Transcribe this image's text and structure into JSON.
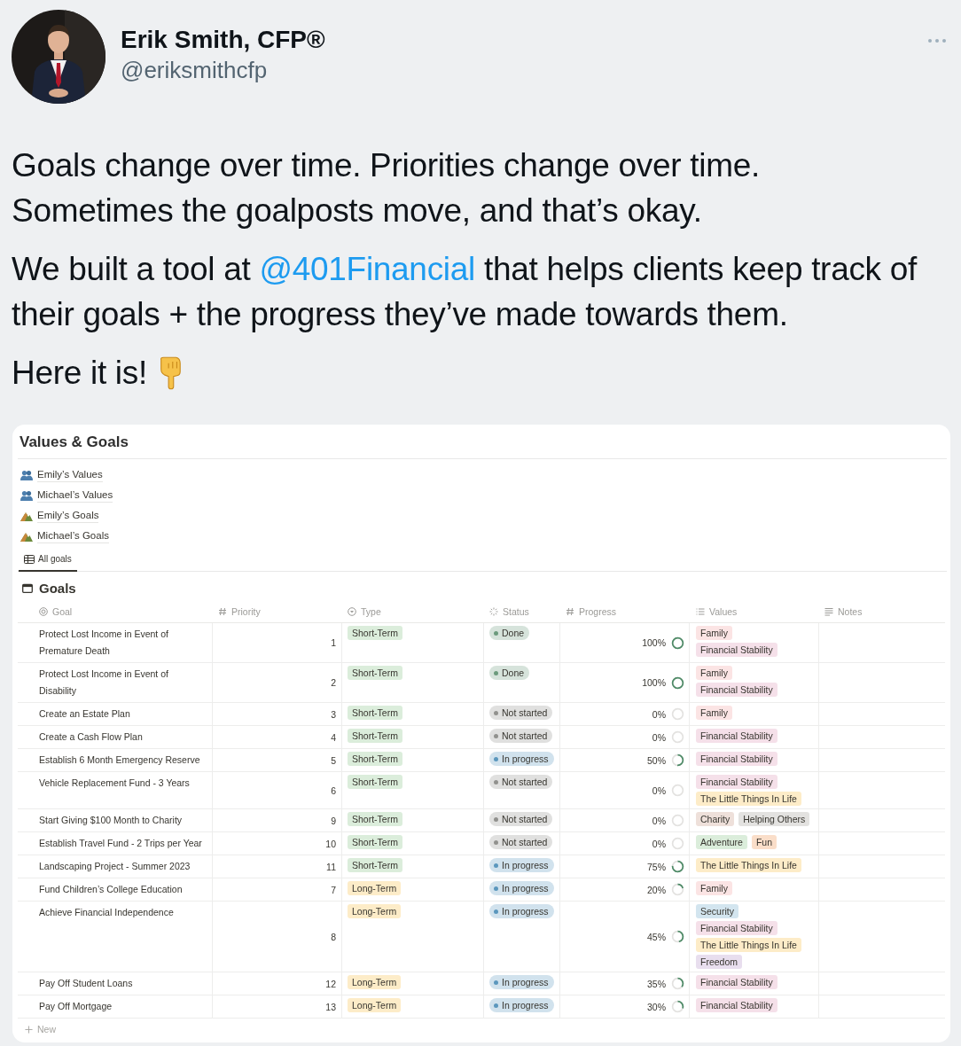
{
  "tweet": {
    "author": {
      "name": "Erik Smith, CFP®",
      "handle": "@eriksmithcfp"
    },
    "paragraphs": [
      {
        "text": "Goals change over time. Priorities change over time.\nSometimes the goalposts move, and that’s okay."
      },
      {
        "before": "We built a tool at ",
        "link": "@401Financial",
        "after": " that helps clients keep track of their goals + the progress they’ve made towards them."
      },
      {
        "text": "Here it is!"
      }
    ]
  },
  "notion": {
    "title": "Values & Goals",
    "links": [
      {
        "label": "Emily’s Values",
        "kind": "values"
      },
      {
        "label": "Michael’s Values",
        "kind": "values"
      },
      {
        "label": "Emily’s Goals",
        "kind": "goals"
      },
      {
        "label": "Michael’s Goals",
        "kind": "goals"
      }
    ],
    "view_tab": {
      "label": "All goals",
      "selected": true
    },
    "database_title": "Goals",
    "columns": [
      {
        "label": "Goal",
        "kind": "title"
      },
      {
        "label": "Priority",
        "kind": "number"
      },
      {
        "label": "Type",
        "kind": "select"
      },
      {
        "label": "Status",
        "kind": "status"
      },
      {
        "label": "Progress",
        "kind": "number"
      },
      {
        "label": "Values",
        "kind": "multi"
      },
      {
        "label": "Notes",
        "kind": "text"
      }
    ],
    "rows": [
      {
        "goal": "Protect Lost Income in Event of Premature Death",
        "priority": "1",
        "type": {
          "label": "Short-Term",
          "color": "#dbeddb"
        },
        "status": {
          "label": "Done",
          "color": "#6c9b7d"
        },
        "progress": "100%",
        "value_lines": [
          [
            {
              "label": "Family",
              "color": "#fbe4e4"
            }
          ],
          [
            {
              "label": "Financial Stability",
              "color": "#f5e0e9"
            }
          ]
        ]
      },
      {
        "goal": "Protect Lost Income in Event of Disability",
        "priority": "2",
        "type": {
          "label": "Short-Term",
          "color": "#dbeddb"
        },
        "status": {
          "label": "Done",
          "color": "#6c9b7d"
        },
        "progress": "100%",
        "value_lines": [
          [
            {
              "label": "Family",
              "color": "#fbe4e4"
            }
          ],
          [
            {
              "label": "Financial Stability",
              "color": "#f5e0e9"
            }
          ]
        ]
      },
      {
        "goal": "Create an Estate Plan",
        "priority": "3",
        "type": {
          "label": "Short-Term",
          "color": "#dbeddb"
        },
        "status": {
          "label": "Not started",
          "color": "#91918e"
        },
        "progress": "0%",
        "value_lines": [
          [
            {
              "label": "Family",
              "color": "#fbe4e4"
            }
          ]
        ]
      },
      {
        "goal": "Create a Cash Flow Plan",
        "priority": "4",
        "type": {
          "label": "Short-Term",
          "color": "#dbeddb"
        },
        "status": {
          "label": "Not started",
          "color": "#91918e"
        },
        "progress": "0%",
        "value_lines": [
          [
            {
              "label": "Financial Stability",
              "color": "#f5e0e9"
            }
          ]
        ]
      },
      {
        "goal": "Establish 6 Month Emergency Reserve",
        "priority": "5",
        "type": {
          "label": "Short-Term",
          "color": "#dbeddb"
        },
        "status": {
          "label": "In progress",
          "color": "#5b97bd"
        },
        "progress": "50%",
        "value_lines": [
          [
            {
              "label": "Financial Stability",
              "color": "#f5e0e9"
            }
          ]
        ]
      },
      {
        "goal": "Vehicle Replacement Fund - 3 Years",
        "priority": "6",
        "type": {
          "label": "Short-Term",
          "color": "#dbeddb"
        },
        "status": {
          "label": "Not started",
          "color": "#91918e"
        },
        "progress": "0%",
        "value_lines": [
          [
            {
              "label": "Financial Stability",
              "color": "#f5e0e9"
            }
          ],
          [
            {
              "label": "The Little Things In Life",
              "color": "#fdecc8"
            }
          ]
        ]
      },
      {
        "goal": "Start Giving $100 Month to Charity",
        "priority": "9",
        "type": {
          "label": "Short-Term",
          "color": "#dbeddb"
        },
        "status": {
          "label": "Not started",
          "color": "#91918e"
        },
        "progress": "0%",
        "value_lines": [
          [
            {
              "label": "Charity",
              "color": "#eee0da"
            },
            {
              "label": "Helping Others",
              "color": "#e3e2e0"
            }
          ]
        ]
      },
      {
        "goal": "Establish Travel Fund - 2 Trips per Year",
        "priority": "10",
        "type": {
          "label": "Short-Term",
          "color": "#dbeddb"
        },
        "status": {
          "label": "Not started",
          "color": "#91918e"
        },
        "progress": "0%",
        "value_lines": [
          [
            {
              "label": "Adventure",
              "color": "#dbeddb"
            },
            {
              "label": "Fun",
              "color": "#fadec9"
            }
          ]
        ]
      },
      {
        "goal": "Landscaping Project - Summer 2023",
        "priority": "11",
        "type": {
          "label": "Short-Term",
          "color": "#dbeddb"
        },
        "status": {
          "label": "In progress",
          "color": "#5b97bd"
        },
        "progress": "75%",
        "value_lines": [
          [
            {
              "label": "The Little Things In Life",
              "color": "#fdecc8"
            }
          ]
        ]
      },
      {
        "goal": "Fund Children’s College Education",
        "priority": "7",
        "type": {
          "label": "Long-Term",
          "color": "#fdecc8"
        },
        "status": {
          "label": "In progress",
          "color": "#5b97bd"
        },
        "progress": "20%",
        "value_lines": [
          [
            {
              "label": "Family",
              "color": "#fbe4e4"
            }
          ]
        ]
      },
      {
        "goal": "Achieve Financial Independence",
        "priority": "8",
        "type": {
          "label": "Long-Term",
          "color": "#fdecc8"
        },
        "status": {
          "label": "In progress",
          "color": "#5b97bd"
        },
        "progress": "45%",
        "value_lines": [
          [
            {
              "label": "Security",
              "color": "#d3e5ef"
            }
          ],
          [
            {
              "label": "Financial Stability",
              "color": "#f5e0e9"
            }
          ],
          [
            {
              "label": "The Little Things In Life",
              "color": "#fdecc8"
            }
          ],
          [
            {
              "label": "Freedom",
              "color": "#e8deee"
            }
          ]
        ]
      },
      {
        "goal": "Pay Off Student Loans",
        "priority": "12",
        "type": {
          "label": "Long-Term",
          "color": "#fdecc8"
        },
        "status": {
          "label": "In progress",
          "color": "#5b97bd"
        },
        "progress": "35%",
        "value_lines": [
          [
            {
              "label": "Financial Stability",
              "color": "#f5e0e9"
            }
          ]
        ]
      },
      {
        "goal": "Pay Off Mortgage",
        "priority": "13",
        "type": {
          "label": "Long-Term",
          "color": "#fdecc8"
        },
        "status": {
          "label": "In progress",
          "color": "#5b97bd"
        },
        "progress": "30%",
        "value_lines": [
          [
            {
              "label": "Financial Stability",
              "color": "#f5e0e9"
            }
          ]
        ]
      }
    ],
    "new_label": "New"
  }
}
